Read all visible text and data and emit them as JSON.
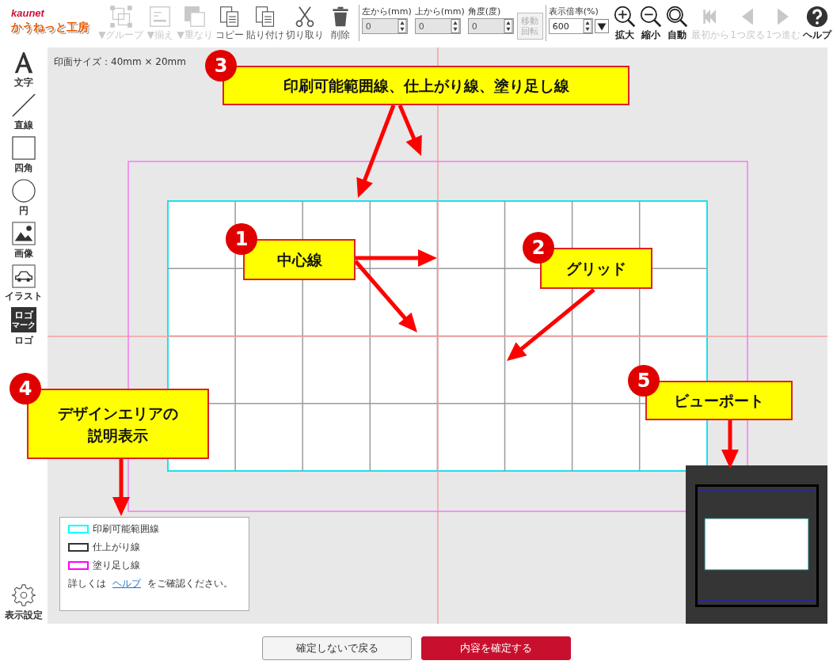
{
  "toolbar": {
    "logo": {
      "brand": "kaunet",
      "title": "かうねっと工房"
    },
    "edit_buttons": [
      {
        "kind": "group",
        "label": "▼グループ",
        "disabled": true
      },
      {
        "kind": "align",
        "label": "▼揃え",
        "disabled": true
      },
      {
        "kind": "order",
        "label": "▼重なり",
        "disabled": true
      },
      {
        "kind": "copy",
        "label": "コピー",
        "disabled": false
      },
      {
        "kind": "paste",
        "label": "貼り付け",
        "disabled": false
      },
      {
        "kind": "cut",
        "label": "切り取り",
        "disabled": false
      },
      {
        "kind": "delete",
        "label": "削除",
        "disabled": false
      }
    ],
    "position_fields": [
      {
        "label": "左から(mm)",
        "value": "0",
        "disabled": true
      },
      {
        "label": "上から(mm)",
        "value": "0",
        "disabled": true
      },
      {
        "label": "角度(度)",
        "value": "0",
        "disabled": true
      }
    ],
    "rotate_button": {
      "lines": [
        "移動",
        "回転"
      ],
      "disabled": true
    },
    "zoom": {
      "label": "表示倍率(%)",
      "value": "600"
    },
    "zoom_buttons": [
      {
        "kind": "zoom-in",
        "label": "拡大"
      },
      {
        "kind": "zoom-out",
        "label": "縮小"
      },
      {
        "kind": "zoom-fit",
        "label": "自動"
      }
    ],
    "history_buttons": [
      {
        "kind": "first",
        "label": "最初から",
        "disabled": true
      },
      {
        "kind": "back",
        "label": "1つ戻る",
        "disabled": true
      },
      {
        "kind": "forward",
        "label": "1つ進む",
        "disabled": true
      }
    ],
    "help": {
      "label": "ヘルプ"
    }
  },
  "sidebar": {
    "tools": [
      {
        "kind": "text",
        "label": "文字"
      },
      {
        "kind": "line",
        "label": "直線"
      },
      {
        "kind": "rect",
        "label": "四角"
      },
      {
        "kind": "circle",
        "label": "円"
      },
      {
        "kind": "image",
        "label": "画像"
      },
      {
        "kind": "illust",
        "label": "イラスト"
      },
      {
        "kind": "logo",
        "label": "ロゴ",
        "icon_text": [
          "ロゴ",
          "マーク"
        ]
      }
    ],
    "settings": {
      "label": "表示設定"
    }
  },
  "canvas": {
    "size_label": "印面サイズ：40mm × 20mm",
    "legend": {
      "items": [
        {
          "label": "印刷可能範囲線",
          "color": "#00ffff"
        },
        {
          "label": "仕上がり線",
          "color": "#333333"
        },
        {
          "label": "塗り足し線",
          "color": "#ff00ff"
        }
      ],
      "note_before": "詳しくは",
      "note_link": "ヘルプ",
      "note_after": "をご確認ください。"
    }
  },
  "callouts": [
    {
      "number": "3",
      "lines": [
        "印刷可能範囲線、仕上がり線、塗り足し線"
      ]
    },
    {
      "number": "1",
      "lines": [
        "中心線"
      ]
    },
    {
      "number": "2",
      "lines": [
        "グリッド"
      ]
    },
    {
      "number": "4",
      "lines": [
        "デザインエリアの",
        "説明表示"
      ]
    },
    {
      "number": "5",
      "lines": [
        "ビューポート"
      ]
    }
  ],
  "footer": {
    "buttons": [
      {
        "kind": "secondary",
        "label": "確定しないで戻る"
      },
      {
        "kind": "primary",
        "label": "内容を確定する"
      }
    ]
  }
}
